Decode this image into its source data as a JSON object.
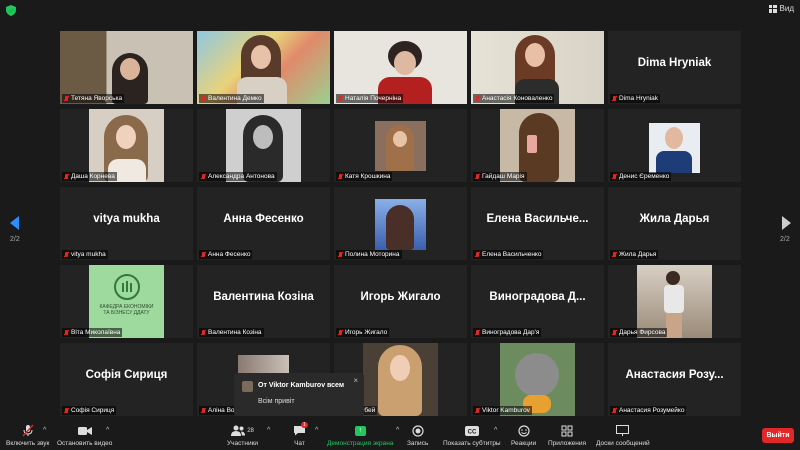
{
  "top": {
    "view_label": "Вид"
  },
  "page_indicator_left": "2/2",
  "page_indicator_right": "2/2",
  "tiles": [
    {
      "name": "Тетяна Яворська",
      "display": ""
    },
    {
      "name": "Валентина Демко",
      "display": ""
    },
    {
      "name": "Наталія Почерніна",
      "display": ""
    },
    {
      "name": "Анастасія Коноваленко",
      "display": ""
    },
    {
      "name": "Dima Hryniak",
      "display": "Dima Hryniak"
    },
    {
      "name": "Даша Корнева",
      "display": ""
    },
    {
      "name": "Александра Антонова",
      "display": ""
    },
    {
      "name": "Катя Крошкина",
      "display": ""
    },
    {
      "name": "Гайдаш Марія",
      "display": ""
    },
    {
      "name": "Денис Єременко",
      "display": ""
    },
    {
      "name": "vitya mukha",
      "display": "vitya mukha"
    },
    {
      "name": "Анна Фесенко",
      "display": "Анна Фесенко"
    },
    {
      "name": "Полина Моторина",
      "display": ""
    },
    {
      "name": "Елена Васильченко",
      "display": "Елена Васильче..."
    },
    {
      "name": "Жила Дарья",
      "display": "Жила Дарья"
    },
    {
      "name": "Віта Миколаївна",
      "display": ""
    },
    {
      "name": "Валентина Козіна",
      "display": "Валентина Козіна"
    },
    {
      "name": "Игорь Жигало",
      "display": "Игорь Жигало"
    },
    {
      "name": "Виноградова Дар'я",
      "display": "Виноградова Д..."
    },
    {
      "name": "Дарья Фирсова",
      "display": ""
    },
    {
      "name": "Софія Сириця",
      "display": "Софія Сириця"
    },
    {
      "name": "Аліна Вола",
      "display": ""
    },
    {
      "name": "...Кочубей",
      "display": ""
    },
    {
      "name": "Viktor Kamburov",
      "display": ""
    },
    {
      "name": "Анастасия Розумейко",
      "display": "Анастасия Розу..."
    }
  ],
  "logo_text": "КАФЕДРА ЕКОНОМІКИ ТА БІЗНЕСУ ДДАТУ",
  "chat_popup": {
    "from": "От Viktor Kamburov всем",
    "message": "Всім привіт",
    "close": "×"
  },
  "toolbar": {
    "audio": "Включить звук",
    "video": "Остановить видео",
    "participants": "Участники",
    "participants_count": "28",
    "chat": "Чат",
    "chat_badge": "1",
    "share": "Демонстрация экрана",
    "record": "Запись",
    "captions": "Показать субтитры",
    "reactions": "Реакции",
    "apps": "Приложения",
    "whiteboard": "Доски сообщений",
    "leave": "Выйти"
  },
  "colors": {
    "accent": "#2d8cff",
    "active_speaker": "#c8e06b",
    "share": "#22c55e",
    "leave": "#e02828"
  }
}
